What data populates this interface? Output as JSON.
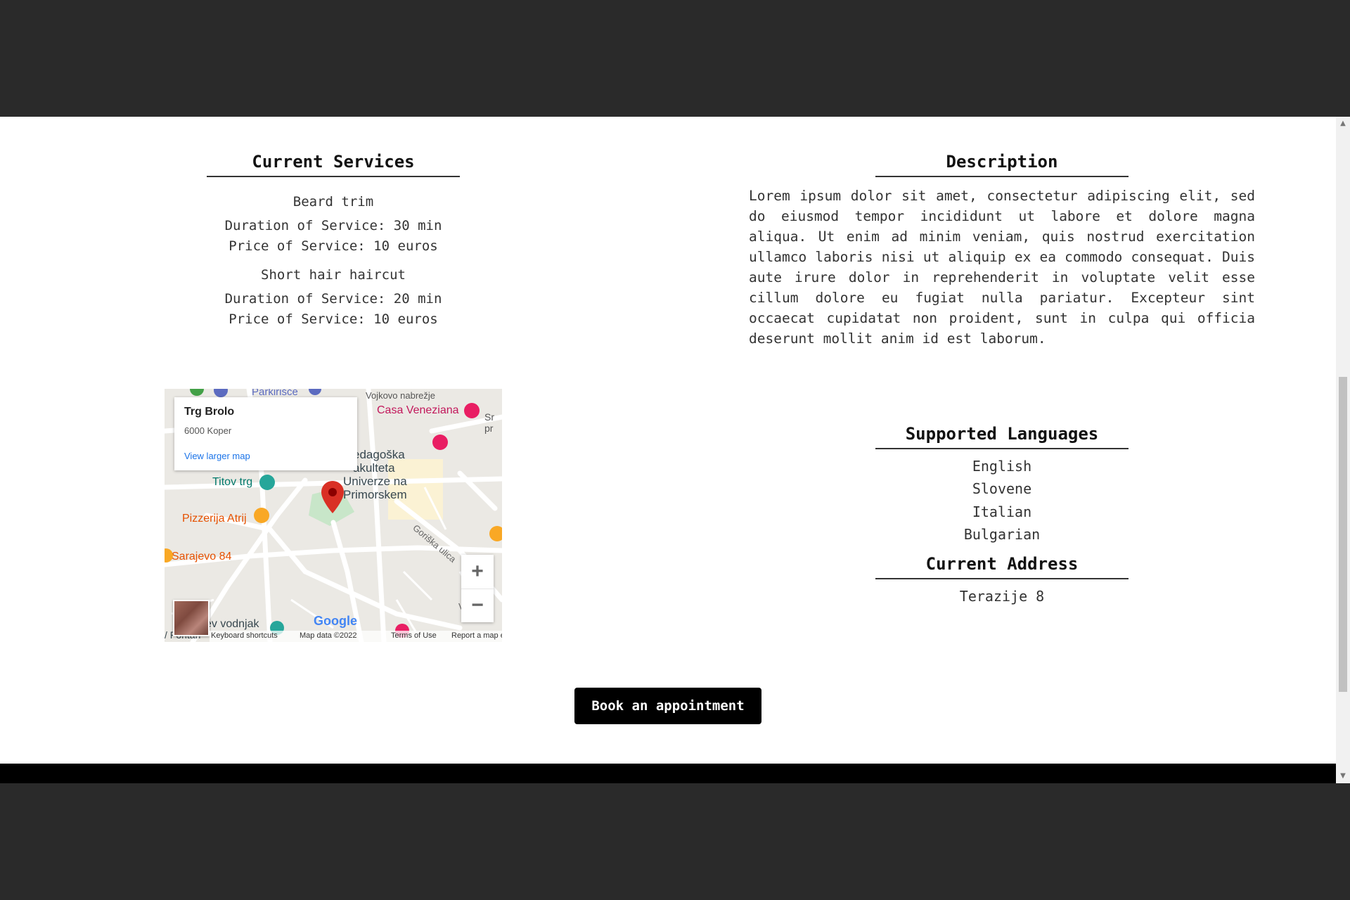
{
  "services": {
    "title": "Current Services",
    "items": [
      {
        "name": "Beard trim",
        "duration": "Duration of Service: 30 min",
        "price": "Price of Service: 10 euros"
      },
      {
        "name": "Short hair haircut",
        "duration": "Duration of Service: 20 min",
        "price": "Price of Service: 10 euros"
      }
    ]
  },
  "description": {
    "title": "Description",
    "text": "Lorem ipsum dolor sit amet, consectetur adipiscing elit, sed do eiusmod tempor incididunt ut labore et dolore magna aliqua. Ut enim ad minim veniam, quis nostrud exercitation ullamco laboris nisi ut aliquip ex ea commodo consequat. Duis aute irure dolor in reprehenderit in voluptate velit esse cillum dolore eu fugiat nulla pariatur. Excepteur sint occaecat cupidatat non proident, sunt in culpa qui officia deserunt mollit anim id est laborum."
  },
  "languages": {
    "title": "Supported Languages",
    "items": [
      "English",
      "Slovene",
      "Italian",
      "Bulgarian"
    ]
  },
  "address": {
    "title": "Current Address",
    "value": "Terazije 8"
  },
  "map": {
    "place_name": "Trg Brolo",
    "place_address": "6000 Koper",
    "larger_map_link": "View larger map",
    "labels": {
      "parking": "Parkirišče",
      "vojkovo": "Vojkovo nabrežje",
      "casa": "Casa Veneziana",
      "titov": "Titov trg",
      "faculty_1": "edagoška",
      "faculty_2": "akulteta",
      "faculty_3": "Univerze na",
      "faculty_4": "Primorskem",
      "pizzeria": "Pizzerija Atrij",
      "sarajevo": "Sarajevo 84",
      "goriska": "Goriška ulica",
      "vodnjak": "ev vodnjak",
      "fontana": "/ Fontan",
      "sr": "Sr",
      "pr": "pr",
      "vol": "Vol"
    },
    "zoom_in": "+",
    "zoom_out": "−",
    "google_logo": "Google",
    "footer": {
      "shortcuts": "Keyboard shortcuts",
      "data": "Map data ©2022",
      "terms": "Terms of Use",
      "report": "Report a map error"
    },
    "colors": {
      "pin": "#d93025",
      "road": "#ffffff",
      "park": "#c8e6c9"
    }
  },
  "actions": {
    "book_label": "Book an appointment"
  },
  "scrollbar": {
    "up": "▲",
    "down": "▼"
  }
}
